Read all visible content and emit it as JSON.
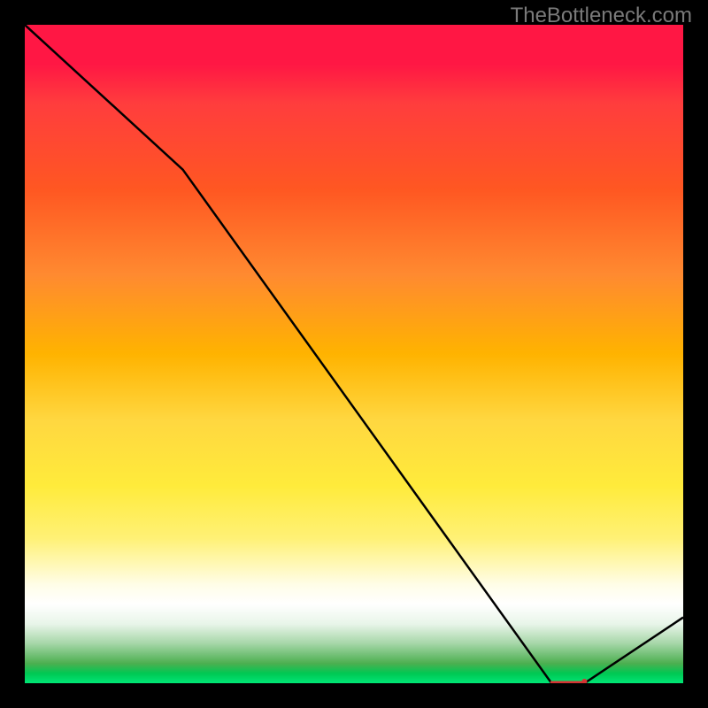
{
  "watermark": "TheBottleneck.com",
  "chart_data": {
    "type": "line",
    "x": [
      0,
      24,
      80,
      85,
      100
    ],
    "values": [
      100,
      78,
      0,
      0,
      10
    ],
    "title": "",
    "xlabel": "",
    "ylabel": "",
    "xlim": [
      0,
      100
    ],
    "ylim": [
      0,
      100
    ],
    "grid": false,
    "dotted_segment": {
      "x_start": 80,
      "x_end": 85
    }
  },
  "colors": {
    "line": "#000000",
    "dotted": "#d63333",
    "background_top": "#ff1744",
    "background_bottom": "#00e676"
  }
}
